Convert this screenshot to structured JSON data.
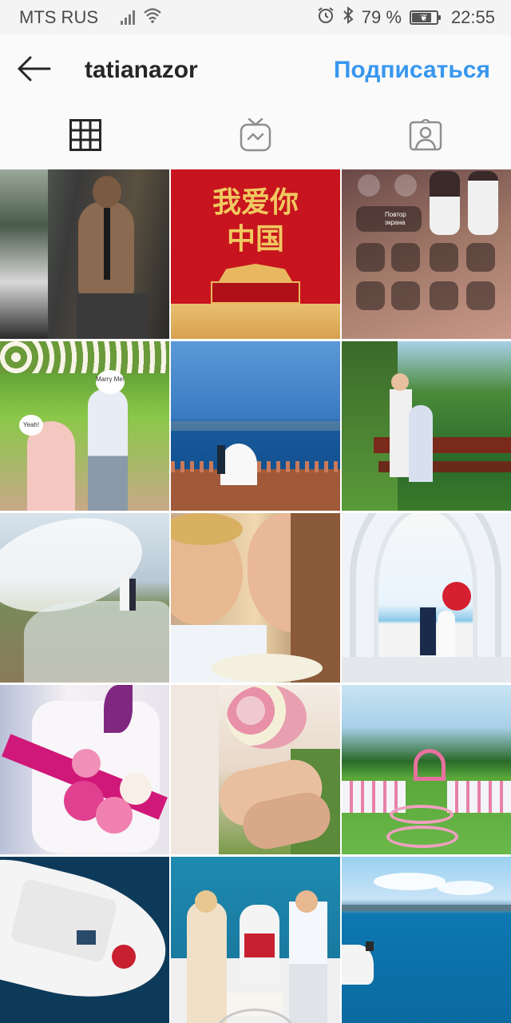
{
  "status_bar": {
    "carrier": "MTS RUS",
    "battery_percent": "79 %",
    "battery_level": 0.79,
    "time": "22:55",
    "icons": [
      "signal-icon",
      "wifi-icon",
      "alarm-icon",
      "bluetooth-icon",
      "battery-icon"
    ]
  },
  "header": {
    "username": "tatianazor",
    "follow_label": "Подписаться",
    "accent_color": "#3897f0"
  },
  "tabs": [
    {
      "name": "grid",
      "icon": "grid-icon",
      "active": true
    },
    {
      "name": "igtv",
      "icon": "tv-icon",
      "active": false
    },
    {
      "name": "tagged",
      "icon": "tagged-user-icon",
      "active": false
    }
  ],
  "posts": [
    {
      "subject": "man-portrait",
      "colors": [
        "#3a3a3a",
        "#8a7a6a"
      ]
    },
    {
      "subject": "chinese-poster",
      "colors": [
        "#c8141e",
        "#e8c070"
      ],
      "text_line1": "我爱你",
      "text_line2": "中国"
    },
    {
      "subject": "control-center",
      "colors": [
        "#5a4040",
        "#c09080"
      ],
      "text": "Повтор экрана"
    },
    {
      "subject": "wedding-garden",
      "colors": [
        "#7ab53a",
        "#f2d2c8"
      ],
      "text": "Marry Me!",
      "text2": "Yeah!"
    },
    {
      "subject": "sea-wedding",
      "colors": [
        "#3a86c8",
        "#0f4e8a"
      ]
    },
    {
      "subject": "garden-bench",
      "colors": [
        "#3a7a2a",
        "#9ac8e8"
      ]
    },
    {
      "subject": "veil-coast",
      "colors": [
        "#c8dce8",
        "#7a8a5a"
      ]
    },
    {
      "subject": "couple-closeup",
      "colors": [
        "#e8c898",
        "#c8a070"
      ]
    },
    {
      "subject": "white-arch",
      "colors": [
        "#e8f0f4",
        "#d42030"
      ]
    },
    {
      "subject": "flower-chair",
      "colors": [
        "#f4f0f4",
        "#d01878"
      ]
    },
    {
      "subject": "hands-bouquet",
      "colors": [
        "#f0e4d8",
        "#e8a0b0"
      ]
    },
    {
      "subject": "beach-ceremony",
      "colors": [
        "#5aa83a",
        "#e8d0d8"
      ]
    },
    {
      "subject": "yacht-aerial",
      "colors": [
        "#0e3a5a",
        "#f4f4f4"
      ]
    },
    {
      "subject": "yacht-couple",
      "colors": [
        "#1e8ab0",
        "#f0e0c8"
      ]
    },
    {
      "subject": "bay-view",
      "colors": [
        "#0e78b0",
        "#9ad0f0"
      ]
    }
  ]
}
